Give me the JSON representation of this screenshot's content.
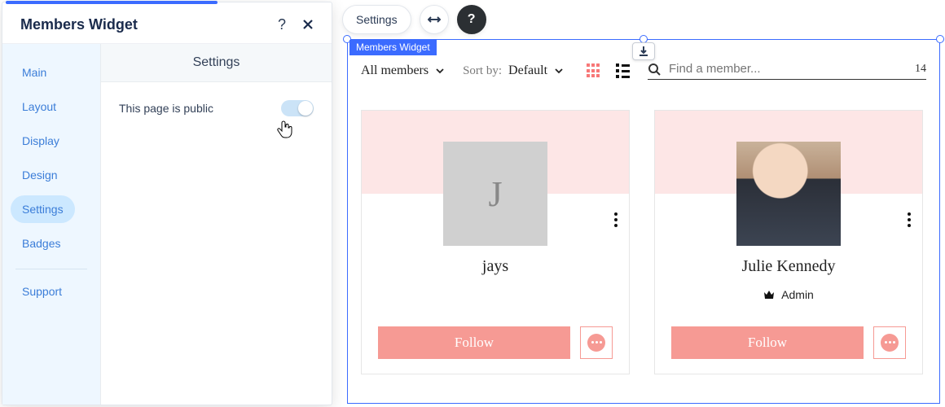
{
  "panel": {
    "title": "Members Widget",
    "sidebar": {
      "items": [
        {
          "label": "Main"
        },
        {
          "label": "Layout"
        },
        {
          "label": "Display"
        },
        {
          "label": "Design"
        },
        {
          "label": "Settings"
        },
        {
          "label": "Badges"
        }
      ],
      "support_label": "Support"
    },
    "content_heading": "Settings",
    "setting_public_label": "This page is public"
  },
  "canvas": {
    "settings_pill": "Settings",
    "frame_tag": "Members Widget",
    "toolbar": {
      "filter_label": "All members",
      "sort_label": "Sort by:",
      "sort_value": "Default",
      "search_placeholder": "Find a member...",
      "count": "14"
    },
    "members": [
      {
        "name": "jays",
        "avatar_initial": "J",
        "has_photo": false,
        "role": "",
        "follow_label": "Follow"
      },
      {
        "name": "Julie Kennedy",
        "avatar_initial": "",
        "has_photo": true,
        "role": "Admin",
        "follow_label": "Follow"
      }
    ]
  }
}
